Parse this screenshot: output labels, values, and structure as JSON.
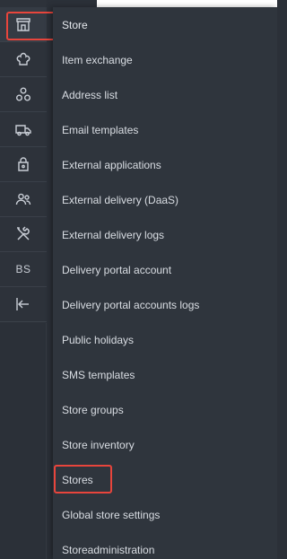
{
  "rail": {
    "items": [
      {
        "icon": "store-icon",
        "active": true
      },
      {
        "icon": "chef-hat-icon",
        "active": false
      },
      {
        "icon": "circles-cluster-icon",
        "active": false
      },
      {
        "icon": "delivery-truck-icon",
        "active": false
      },
      {
        "icon": "lock-icon",
        "active": false
      },
      {
        "icon": "users-icon",
        "active": false
      },
      {
        "icon": "tools-icon",
        "active": false
      },
      {
        "icon": "text-badge",
        "label": "BS",
        "active": false
      },
      {
        "icon": "collapse-left-icon",
        "active": false
      }
    ]
  },
  "menu": {
    "header": "Store",
    "items": [
      "Item exchange",
      "Address list",
      "Email templates",
      "External applications",
      "External delivery (DaaS)",
      "External delivery logs",
      "Delivery portal account",
      "Delivery portal accounts logs",
      "Public holidays",
      "SMS templates",
      "Store groups",
      "Store inventory",
      "Stores",
      "Global store settings",
      "Storeadministration"
    ],
    "highlighted": [
      "Store",
      "Stores"
    ]
  },
  "colors": {
    "rail_bg": "#2d323a",
    "menu_bg": "#2f353d",
    "text": "#d9dde3",
    "highlight": "#e8453c"
  }
}
